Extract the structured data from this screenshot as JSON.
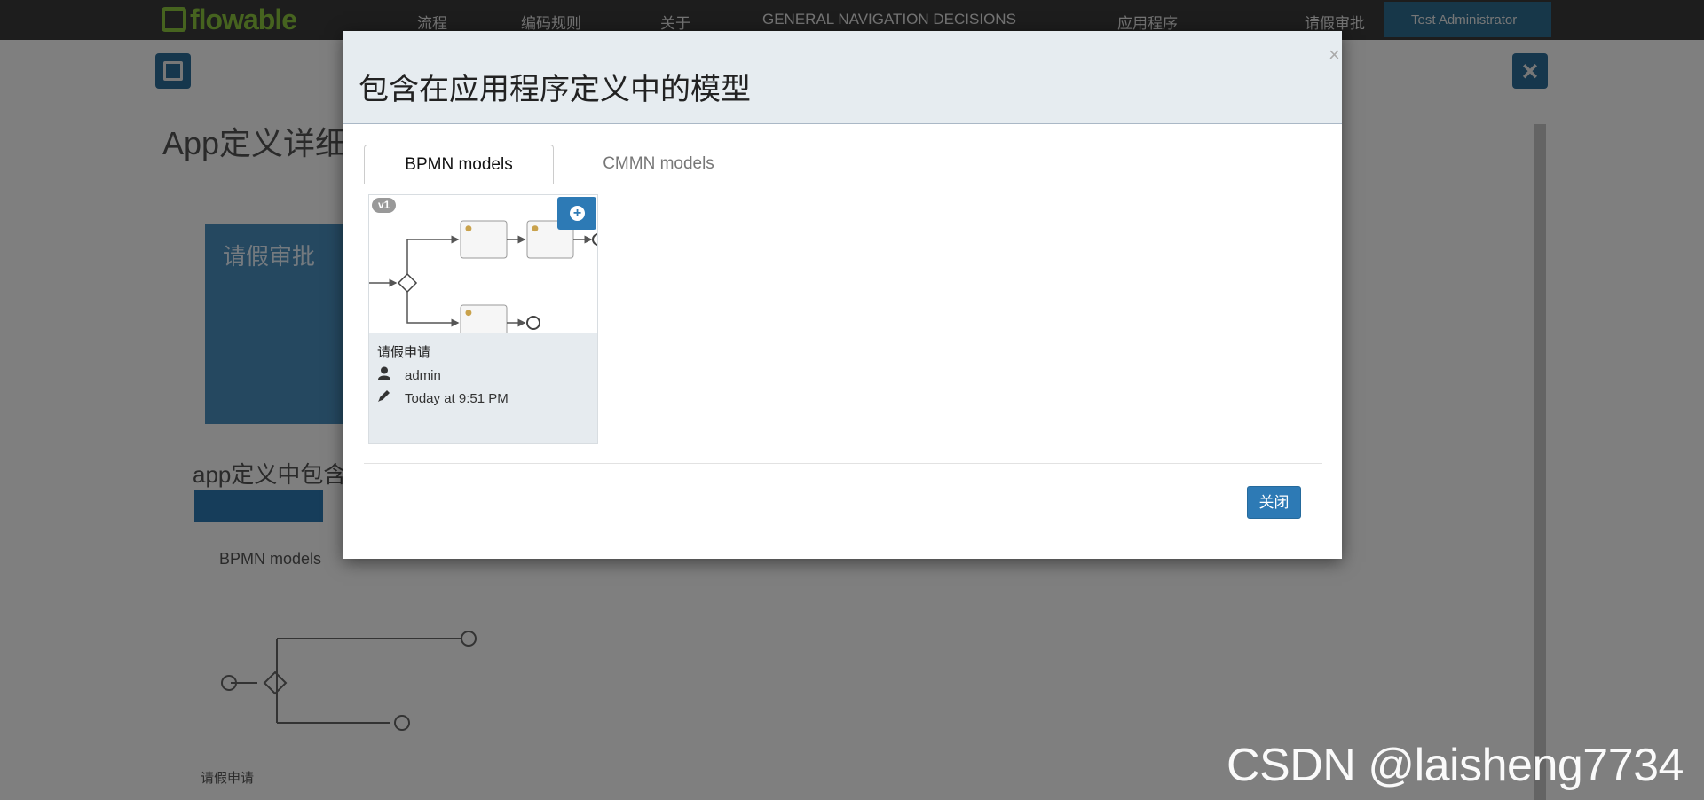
{
  "navbar": {
    "logo": "flowable",
    "items": [
      "流程",
      "编码规则",
      "关于",
      "GENERAL NAVIGATION DECISIONS",
      "应用程序"
    ],
    "user_task": "请假审批",
    "user_name": "Test Administrator"
  },
  "background": {
    "title": "App定义详细",
    "card_title": "请假审批",
    "section_title": "app定义中包含",
    "tab_label": "BPMN models",
    "model_label": "请假申请"
  },
  "modal": {
    "title": "包含在应用程序定义中的模型",
    "close_symbol": "×",
    "tabs": [
      "BPMN models",
      "CMMN models"
    ],
    "active_tab": "BPMN models",
    "models": [
      {
        "version": "v1",
        "name": "请假申请",
        "author": "admin",
        "updated": "Today at 9:51 PM",
        "add_icon": "plus-circle-icon",
        "author_icon": "user-icon",
        "time_icon": "pencil-icon"
      }
    ],
    "close_button": "关闭"
  },
  "watermark": "CSDN @laisheng7734",
  "colors": {
    "primary": "#2d7ab5",
    "header_bg": "#e6ecf0",
    "card_bg": "#e6ebef",
    "overlay": "rgba(0,0,0,0.5)",
    "navbar": "#3a3a3a",
    "logo": "#8dc63f"
  }
}
